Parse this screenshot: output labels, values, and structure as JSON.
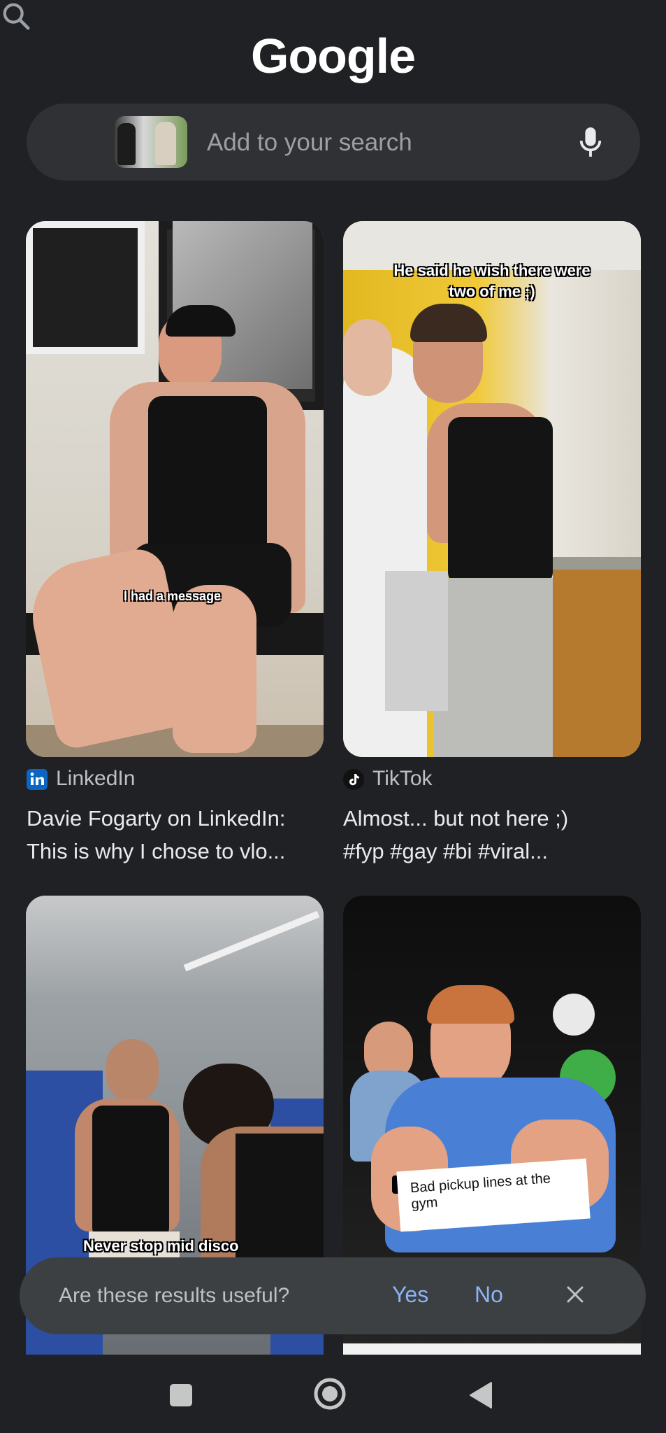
{
  "header": {
    "logo": "Google"
  },
  "search": {
    "placeholder": "Add to your search"
  },
  "results": [
    {
      "source": "LinkedIn",
      "title_line1": "Davie Fogarty on LinkedIn:",
      "title_line2": "This is why I chose to vlo...",
      "overlay": "I had a message"
    },
    {
      "source": "TikTok",
      "title_line1": "Almost... but not here ;)",
      "title_line2": "#fyp #gay #bi #viral...",
      "overlay_line1": "He said he wish there were",
      "overlay_line2": "two of me ;)"
    },
    {
      "overlay": "Never stop mid disco"
    },
    {
      "overlay_line1": "Bad pickup lines at the",
      "overlay_line2": "gym"
    }
  ],
  "feedback": {
    "question": "Are these results useful?",
    "yes": "Yes",
    "no": "No"
  },
  "colors": {
    "background": "#202124",
    "accent": "#8ab4f8",
    "surface": "#303134"
  },
  "icons": [
    "search-icon",
    "mic-icon",
    "linkedin-icon",
    "tiktok-icon",
    "close-icon",
    "recents-icon",
    "home-icon",
    "back-icon"
  ]
}
